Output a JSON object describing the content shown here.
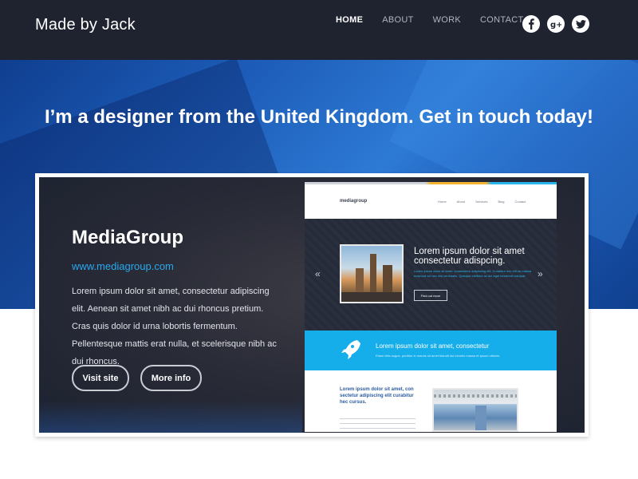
{
  "header": {
    "brand": "Made by Jack",
    "nav": [
      "HOME",
      "ABOUT",
      "WORK",
      "CONTACT"
    ],
    "active_nav": "HOME",
    "social_icons": [
      "facebook-icon",
      "google-plus-icon",
      "twitter-icon"
    ]
  },
  "hero": {
    "tagline_plain": "I’m a designer from the United Kingdom. ",
    "tagline_bold": "Get in touch today!"
  },
  "project": {
    "title": "MediaGroup",
    "url": "www.mediagroup.com",
    "description": "Lorem ipsum dolor sit amet, consectetur adipiscing elit. Aenean sit amet nibh ac dui rhoncus pretium. Cras quis dolor id urna lobortis fermentum. Pellentesque mattis erat nulla, et scelerisque nibh ac dui rhoncus.",
    "buttons": {
      "visit": "Visit site",
      "info": "More info"
    }
  },
  "preview": {
    "logo": "mediagroup",
    "nav": [
      "Home",
      "About",
      "Services",
      "Blog",
      "Contact"
    ],
    "slider_heading": "Lorem ipsum dolor sit amet consectetur adispcing.",
    "slider_sub": "Lorem ipsum dolor sit amet, consectetur adipiscing elit. Curabitur nec elit eu massa euismod vel nec nisi venenatis. Quisque eleifend ac dui eget hendrerit volutpat.",
    "slider_button": "Find out more",
    "band_title": "Lorem ipsum dolor sit amet, consectetur",
    "band_sub": "Etiam felis augue, porttitor in mauris sit amet blandit dui lobortis massa et ipsum ultrices.",
    "lower_title": "Lorem ipsum dolor sit amet, con sectetur adipiscing elit curabitur hec cursus."
  },
  "colors": {
    "header_bg": "#1f2330",
    "accent_blue": "#29a8f0",
    "band_blue": "#15adea"
  }
}
